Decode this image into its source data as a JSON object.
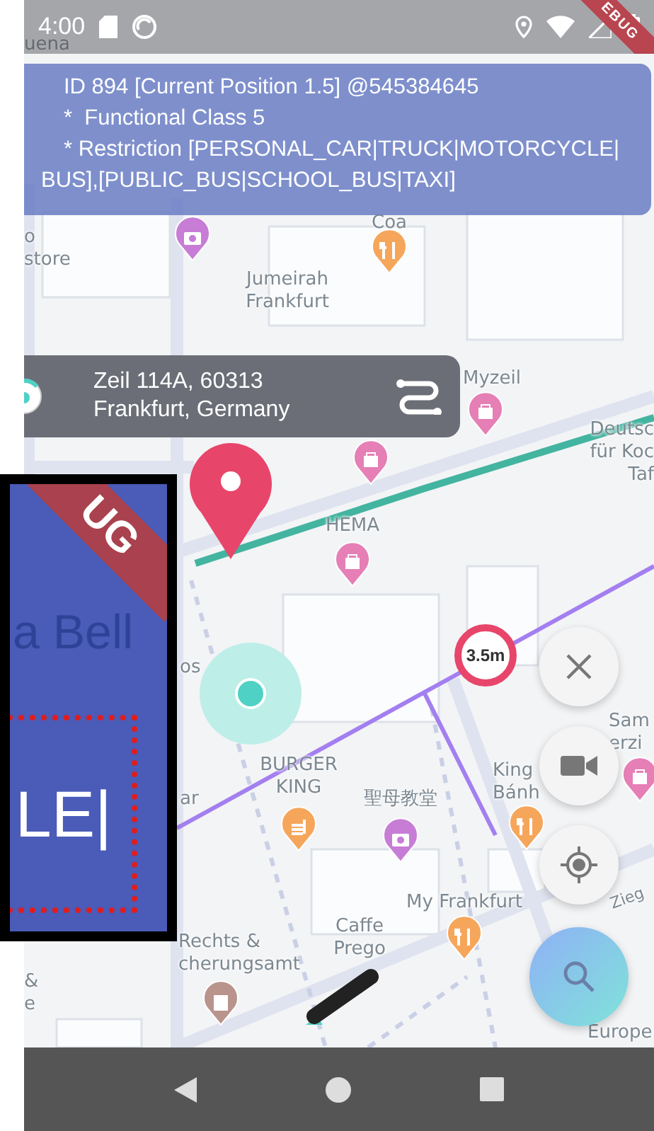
{
  "status_bar": {
    "time": "4:00"
  },
  "debug_ribbon": {
    "label": "EBUG"
  },
  "info_panel": {
    "lines": [
      "ID 894 [Current Position 1.5] @545384645",
      "*  Functional Class 5",
      "* Restriction [PERSONAL_CAR|TRUCK|MOTORCYCLE|",
      "BUS],[PUBLIC_BUS|SCHOOL_BUS|TAXI]"
    ]
  },
  "address_card": {
    "lines": [
      "Zeil 114A, 60313",
      "Frankfurt, Germany"
    ]
  },
  "map": {
    "labels": [
      "uena",
      "Coa",
      "o\nstore",
      "Jumeirah\nFrankfurt",
      "Myzeil",
      "Deutsc\nfür Koc\nTaf",
      "HEMA",
      "os",
      "ar",
      "BURGER\nKING",
      "聖母教堂",
      "King\nBánh",
      "Sam\nerzi",
      "Zieg",
      "My Frankfurt",
      "Caffe\nPrego",
      "Rechts &\ncherungsamt",
      "&\ne",
      "Europe"
    ],
    "pois": [
      {
        "kind": "camera",
        "color": "#c77dd6"
      },
      {
        "kind": "food",
        "color": "#f5a65b"
      },
      {
        "kind": "shop",
        "color": "#e57fb5"
      },
      {
        "kind": "shop",
        "color": "#e57fb5"
      },
      {
        "kind": "shop",
        "color": "#e57fb5"
      },
      {
        "kind": "fastfood",
        "color": "#f5a65b"
      },
      {
        "kind": "camera",
        "color": "#c77dd6"
      },
      {
        "kind": "food",
        "color": "#f5a65b"
      },
      {
        "kind": "shop",
        "color": "#e57fb5"
      },
      {
        "kind": "food",
        "color": "#f5a65b"
      },
      {
        "kind": "building",
        "color": "#b8948c"
      }
    ],
    "height_limit": {
      "text": "3.5m"
    }
  },
  "zoom_inset": {
    "ribbon": "UG",
    "label": "a Bell",
    "highlight": "LE|"
  }
}
